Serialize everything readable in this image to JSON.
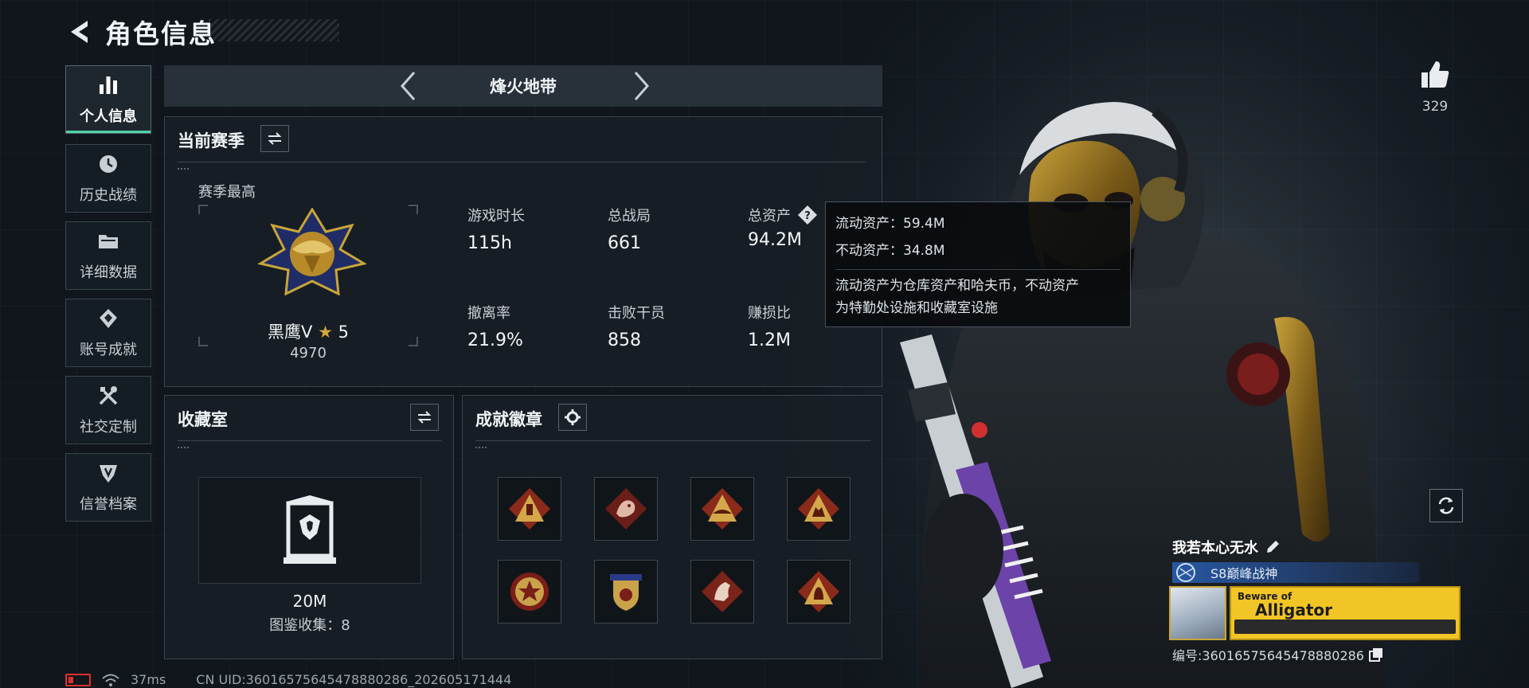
{
  "header": {
    "title": "角色信息"
  },
  "sidebar": {
    "items": [
      {
        "label": "个人信息",
        "icon": "bar-chart-icon",
        "active": true
      },
      {
        "label": "历史战绩",
        "icon": "history-icon",
        "active": false
      },
      {
        "label": "详细数据",
        "icon": "folder-icon",
        "active": false
      },
      {
        "label": "账号成就",
        "icon": "achievement-icon",
        "active": false
      },
      {
        "label": "社交定制",
        "icon": "tools-icon",
        "active": false
      },
      {
        "label": "信誉档案",
        "icon": "shield-badge-icon",
        "active": false
      }
    ]
  },
  "mode_tab": {
    "title": "烽火地带"
  },
  "season": {
    "title": "当前赛季",
    "best_label": "赛季最高",
    "rank_name": "黑鹰Ⅴ",
    "rank_stars": "5",
    "rank_score": "4970",
    "stats": [
      {
        "label": "游戏时长",
        "value": "115h"
      },
      {
        "label": "总战局",
        "value": "661"
      },
      {
        "label": "总资产",
        "value": "94.2M"
      },
      {
        "label": "撤离率",
        "value": "21.9%"
      },
      {
        "label": "击败干员",
        "value": "858"
      },
      {
        "label": "赚损比",
        "value": "1.2M"
      }
    ]
  },
  "tooltip": {
    "liquid": "流动资产：59.4M",
    "fixed": "不动资产：34.8M",
    "desc_line1": "流动资产为仓库资产和哈夫币，不动资产",
    "desc_line2": "为特勤处设施和收藏室设施"
  },
  "collection": {
    "title": "收藏室",
    "value": "20M",
    "catalog": "图鉴收集：8"
  },
  "badges": {
    "title": "成就徽章",
    "items": [
      "badge-1",
      "badge-2",
      "badge-3",
      "badge-4",
      "badge-5",
      "badge-6",
      "badge-7",
      "badge-8"
    ]
  },
  "likes": {
    "count": "329"
  },
  "player": {
    "name": "我若本心无水",
    "rank_title": "S8巅峰战神",
    "banner_top": "Beware of",
    "banner_main": "Alligator",
    "id": "编号:360165756454788802​86"
  },
  "status": {
    "ping": "37ms",
    "uid": "CN UID:360165756454788802​86_202605171444"
  },
  "colors": {
    "accent": "#4fd1a5",
    "gold": "#c9a53a",
    "battery_low": "#e03030",
    "rank_bar": "#2a5aaa"
  }
}
